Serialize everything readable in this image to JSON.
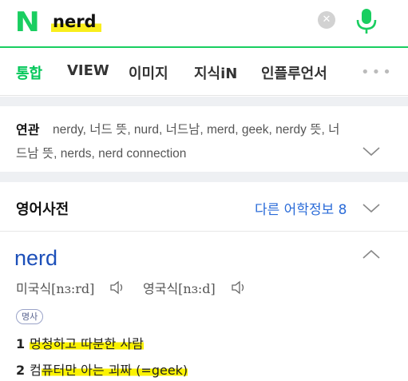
{
  "search": {
    "logo": "N",
    "query": "nerd",
    "clear_icon": "close-icon",
    "mic_icon": "microphone-icon"
  },
  "tabs": [
    {
      "label": "통합",
      "active": true
    },
    {
      "label": "VIEW"
    },
    {
      "label": "이미지"
    },
    {
      "label": "지식iN"
    },
    {
      "label": "인플루언서"
    }
  ],
  "more_label": "•••",
  "related": {
    "title": "연관",
    "line1": "nerdy, 너드 뜻, nurd, 너드남, merd, geek, nerdy 뜻, 너",
    "line2": "드남 뜻, nerds, nerd connection"
  },
  "dictionary": {
    "title": "영어사전",
    "more": "다른 어학정보 8",
    "word": "nerd",
    "pron_us_label": "미국식",
    "pron_us": "[nɜ:rd]",
    "pron_uk_label": "영국식",
    "pron_uk": "[nɜ:d]",
    "pos": "명사",
    "senses": [
      {
        "num": "1",
        "plain": "",
        "hl": "멍청하고 따분한 사람"
      },
      {
        "num": "2",
        "plain": "컴",
        "hl": "퓨터만 아는 괴짜 (=geek)"
      }
    ]
  },
  "colors": {
    "brand": "#03c75a",
    "link": "#2a6bd8",
    "headword": "#1c4fb9",
    "highlight": "#fbf200"
  }
}
